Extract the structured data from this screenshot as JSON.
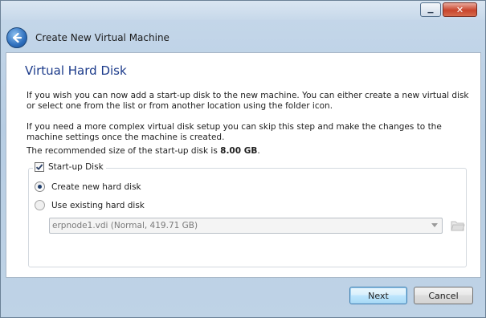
{
  "window": {
    "min_glyph": "▁",
    "close_glyph": "✕"
  },
  "header": {
    "title": "Create New Virtual Machine"
  },
  "page": {
    "title": "Virtual Hard Disk",
    "para1": "If you wish you can now add a start-up disk to the new machine. You can either create a new virtual disk or select one from the list or from another location using the folder icon.",
    "para2": "If you need a more complex virtual disk setup you can skip this step and make the changes to the machine settings once the machine is created.",
    "recommended_prefix": "The recommended size of the start-up disk is ",
    "recommended_size": "8.00 GB",
    "recommended_suffix": "."
  },
  "startup_disk": {
    "label": "Start-up Disk",
    "checked": true,
    "create_new_label": "Create new hard disk",
    "use_existing_label": "Use existing hard disk",
    "selected_option": "create_new",
    "existing_disk_value": "erpnode1.vdi (Normal, 419.71 GB)"
  },
  "buttons": {
    "next": "Next",
    "cancel": "Cancel"
  },
  "icons": {
    "back": "back-arrow-icon",
    "folder": "folder-open-icon",
    "checkbox": "checkmark-icon",
    "dropdown": "chevron-down-icon"
  }
}
